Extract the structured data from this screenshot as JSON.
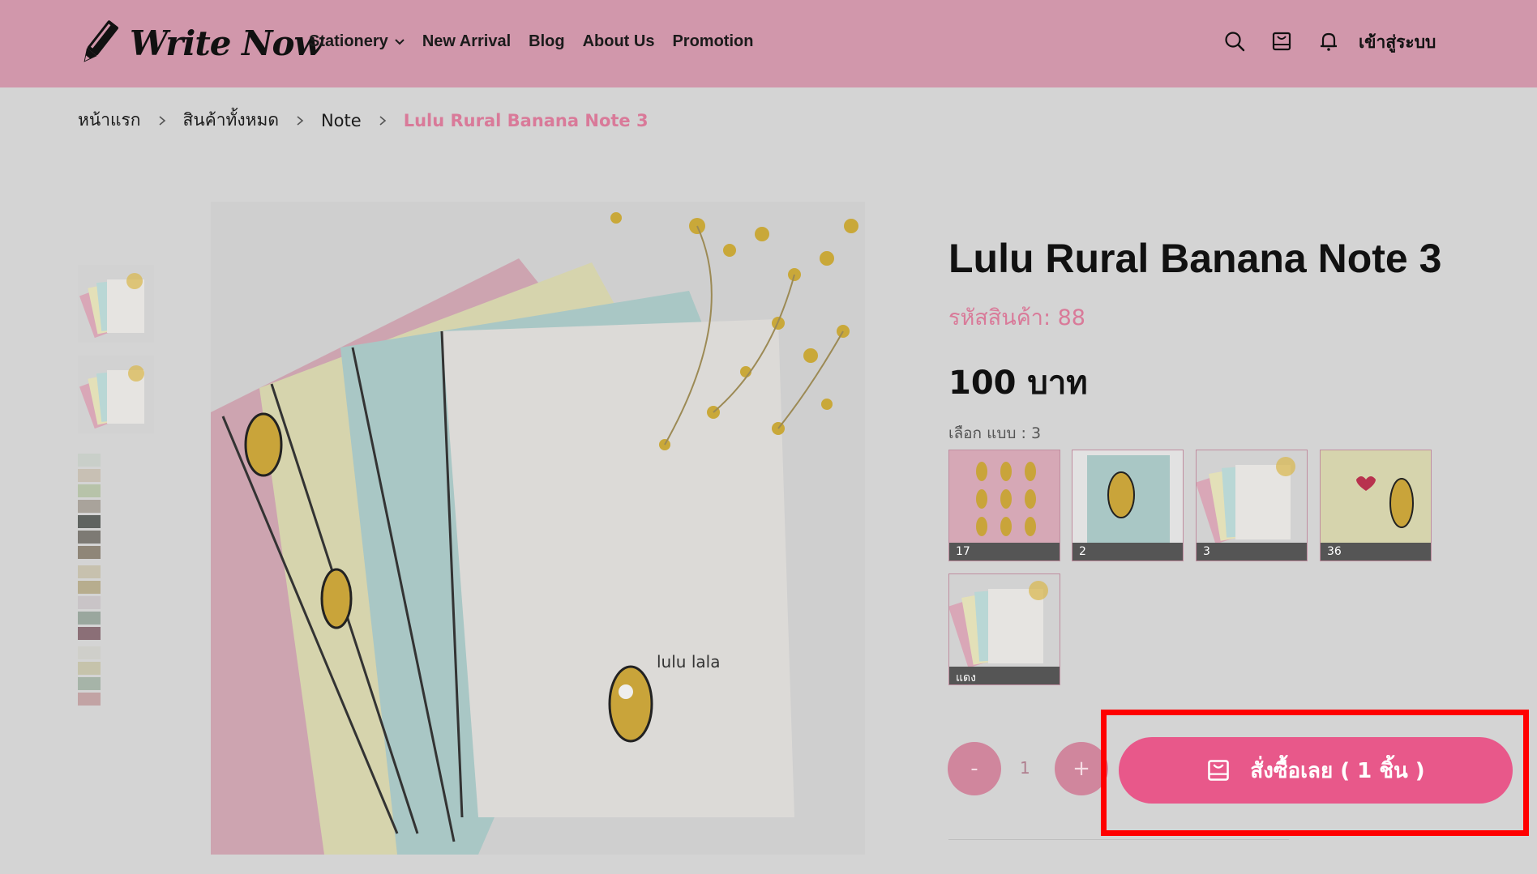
{
  "header": {
    "logo_text": "Write Now",
    "nav": [
      {
        "label": "Stationery",
        "has_dropdown": true
      },
      {
        "label": "New Arrival",
        "has_dropdown": false
      },
      {
        "label": "Blog",
        "has_dropdown": false
      },
      {
        "label": "About Us",
        "has_dropdown": false
      },
      {
        "label": "Promotion",
        "has_dropdown": false
      }
    ],
    "icons": [
      "search-icon",
      "cart-icon",
      "bell-icon"
    ],
    "login_label": "เข้าสู่ระบบ"
  },
  "breadcrumb": [
    {
      "label": "หน้าแรก",
      "current": false
    },
    {
      "label": "สินค้าทั้งหมด",
      "current": false
    },
    {
      "label": "Note",
      "current": false
    },
    {
      "label": "Lulu Rural Banana Note 3",
      "current": true
    }
  ],
  "product": {
    "title": "Lulu Rural Banana Note 3",
    "code": "รหัสสินค้า: 88",
    "price": "100 บาท",
    "variant_label": "เลือก แบบ : 3",
    "variants": [
      {
        "caption": "17"
      },
      {
        "caption": "2"
      },
      {
        "caption": "3"
      },
      {
        "caption": "36"
      },
      {
        "caption": "แดง"
      }
    ],
    "main_image_text": "lulu lala"
  },
  "purchase": {
    "minus_label": "-",
    "quantity": "1",
    "plus_label": "+",
    "buy_label": "สั่งซื้อเลย ( 1 ชิ้น )"
  },
  "colors": {
    "header_bg": "#d197ab",
    "accent_pink": "#e8588a",
    "highlight": "#ff0000"
  }
}
